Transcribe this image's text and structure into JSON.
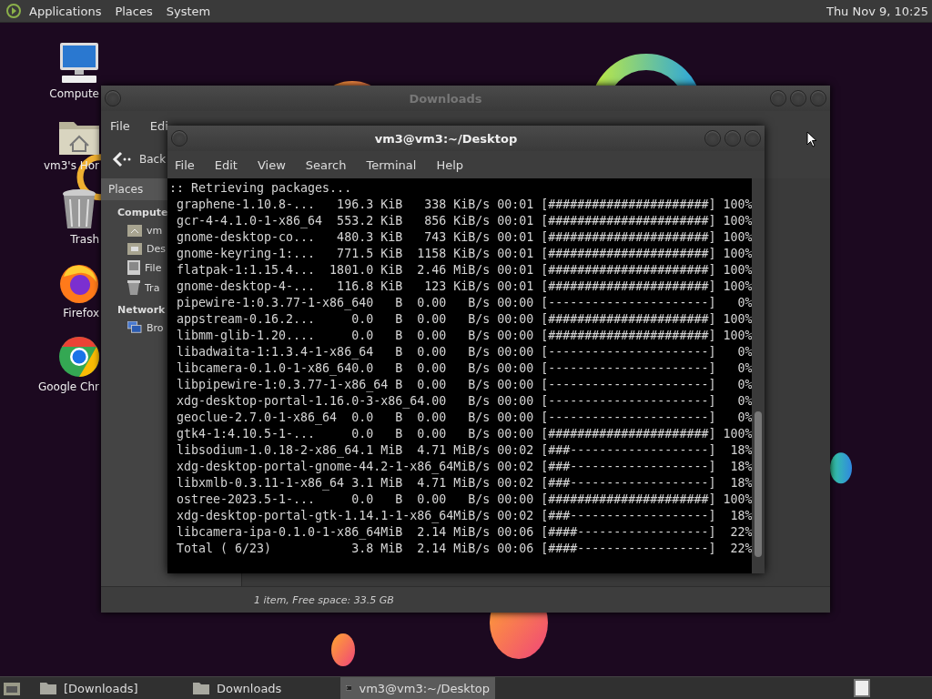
{
  "top_panel": {
    "menus": [
      "Applications",
      "Places",
      "System"
    ],
    "clock": "Thu Nov 9, 10:25"
  },
  "desktop_icons": [
    {
      "label": "Compute",
      "kind": "computer"
    },
    {
      "label": "vm3's Hor",
      "kind": "home"
    },
    {
      "label": "Trash",
      "kind": "trash"
    },
    {
      "label": "Firefox",
      "kind": "firefox"
    },
    {
      "label": "Google Chr",
      "kind": "chrome"
    }
  ],
  "file_manager": {
    "title": "Downloads",
    "menu": [
      "File",
      "Edi"
    ],
    "back": "Back",
    "sidebar": {
      "header": "Places",
      "sections": [
        {
          "label": "Compute",
          "items": [
            {
              "label": "vm",
              "kind": "home"
            },
            {
              "label": "Des",
              "kind": "desktop"
            },
            {
              "label": "File",
              "kind": "drive"
            },
            {
              "label": "Tra",
              "kind": "trash"
            }
          ]
        },
        {
          "label": "Network",
          "items": [
            {
              "label": "Bro",
              "kind": "network"
            }
          ]
        }
      ]
    },
    "status": "1 item, Free space: 33.5 GB"
  },
  "terminal": {
    "title": "vm3@vm3:~/Desktop",
    "menu": [
      "File",
      "Edit",
      "View",
      "Search",
      "Terminal",
      "Help"
    ],
    "lines": [
      ":: Retrieving packages...",
      " graphene-1.10.8-...   196.3 KiB   338 KiB/s 00:01 [######################] 100%",
      " gcr-4-4.1.0-1-x86_64  553.2 KiB   856 KiB/s 00:01 [######################] 100%",
      " gnome-desktop-co...   480.3 KiB   743 KiB/s 00:01 [######################] 100%",
      " gnome-keyring-1:...   771.5 KiB  1158 KiB/s 00:01 [######################] 100%",
      " flatpak-1:1.15.4...  1801.0 KiB  2.46 MiB/s 00:01 [######################] 100%",
      " gnome-desktop-4-...   116.8 KiB   123 KiB/s 00:01 [######################] 100%",
      " pipewire-1:0.3.77-1-x86_640   B  0.00   B/s 00:00 [----------------------]   0%",
      " appstream-0.16.2...     0.0   B  0.00   B/s 00:00 [######################] 100%",
      " libmm-glib-1.20....     0.0   B  0.00   B/s 00:00 [######################] 100%",
      " libadwaita-1:1.3.4-1-x86_64   B  0.00   B/s 00:00 [----------------------]   0%",
      " libcamera-0.1.0-1-x86_640.0   B  0.00   B/s 00:00 [----------------------]   0%",
      " libpipewire-1:0.3.77-1-x86_64 B  0.00   B/s 00:00 [----------------------]   0%",
      " xdg-desktop-portal-1.16.0-3-x86_64.00   B/s 00:00 [----------------------]   0%",
      " geoclue-2.7.0-1-x86_64  0.0   B  0.00   B/s 00:00 [----------------------]   0%",
      " gtk4-1:4.10.5-1-...     0.0   B  0.00   B/s 00:00 [######################] 100%",
      " libsodium-1.0.18-2-x86_64.1 MiB  4.71 MiB/s 00:02 [###-------------------]  18%",
      " xdg-desktop-portal-gnome-44.2-1-x86_64MiB/s 00:02 [###-------------------]  18%",
      " libxmlb-0.3.11-1-x86_64 3.1 MiB  4.71 MiB/s 00:02 [###-------------------]  18%",
      " ostree-2023.5-1-...     0.0   B  0.00   B/s 00:00 [######################] 100%",
      " xdg-desktop-portal-gtk-1.14.1-1-x86_64MiB/s 00:02 [###-------------------]  18%",
      " libcamera-ipa-0.1.0-1-x86_64MiB  2.14 MiB/s 00:06 [####------------------]  22%",
      " Total ( 6/23)           3.8 MiB  2.14 MiB/s 00:06 [####------------------]  22%"
    ]
  },
  "taskbar": {
    "items": [
      {
        "label": "[Downloads]",
        "kind": "folder",
        "selected": false
      },
      {
        "label": "Downloads",
        "kind": "folder",
        "selected": false
      },
      {
        "label": "vm3@vm3:~/Desktop",
        "kind": "terminal",
        "selected": true
      }
    ]
  }
}
